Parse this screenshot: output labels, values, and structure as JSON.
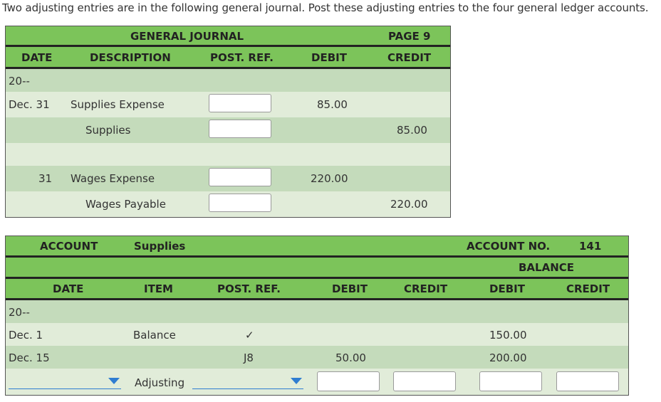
{
  "instructions": "Two adjusting entries are in the following general journal. Post these adjusting entries to the four general ledger accounts.",
  "journal": {
    "title": "GENERAL JOURNAL",
    "page": "PAGE 9",
    "columns": {
      "date": "DATE",
      "description": "DESCRIPTION",
      "post_ref": "POST. REF.",
      "debit": "DEBIT",
      "credit": "CREDIT"
    },
    "year": "20--",
    "rows": [
      {
        "date": "Dec. 31",
        "description": "Supplies Expense",
        "debit": "85.00",
        "credit": ""
      },
      {
        "date": "",
        "description": "Supplies",
        "debit": "",
        "credit": "85.00"
      },
      {
        "date": "31",
        "description": "Wages Expense",
        "debit": "220.00",
        "credit": ""
      },
      {
        "date": "",
        "description": "Wages Payable",
        "debit": "",
        "credit": "220.00"
      }
    ]
  },
  "ledger": {
    "account_label": "ACCOUNT",
    "account_name": "Supplies",
    "account_no_label": "ACCOUNT NO.",
    "account_no": "141",
    "balance_label": "BALANCE",
    "columns": {
      "date": "DATE",
      "item": "ITEM",
      "post_ref": "POST. REF.",
      "debit": "DEBIT",
      "credit": "CREDIT",
      "bal_debit": "DEBIT",
      "bal_credit": "CREDIT"
    },
    "year": "20--",
    "rows": [
      {
        "date": "Dec. 1",
        "item": "Balance",
        "post_ref": "✓",
        "debit": "",
        "credit": "",
        "bal_debit": "150.00",
        "bal_credit": ""
      },
      {
        "date": "Dec. 15",
        "item": "",
        "post_ref": "J8",
        "debit": "50.00",
        "credit": "",
        "bal_debit": "200.00",
        "bal_credit": ""
      }
    ],
    "entry_row": {
      "date_value": "",
      "item": "Adjusting",
      "post_ref_value": ""
    }
  }
}
